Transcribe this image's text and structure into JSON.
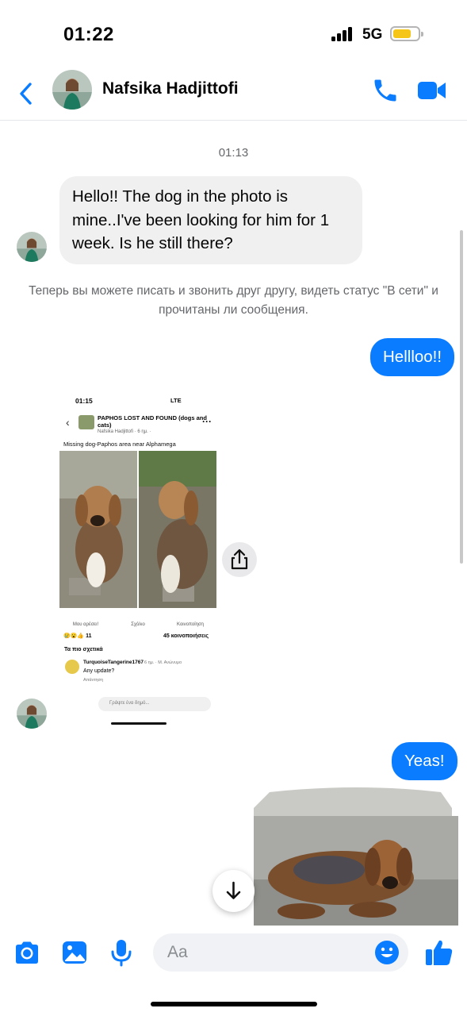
{
  "status_bar": {
    "time": "01:22",
    "network": "5G",
    "battery_color": "#f5c518"
  },
  "header": {
    "contact_name": "Nafsika Hadjittofi",
    "back_icon": "chevron-left-icon",
    "call_icon": "phone-icon",
    "video_icon": "video-camera-icon",
    "accent": "#0a7cff"
  },
  "chat": {
    "timestamp": "01:13",
    "messages": [
      {
        "direction": "incoming",
        "text": "Hello!! The dog in the photo is mine..I've been looking for him for 1 week. Is he still there?"
      },
      {
        "direction": "system",
        "text": "Теперь вы можете писать и звонить друг другу, видеть статус \"В сети\" и прочитаны ли сообщения."
      },
      {
        "direction": "outgoing",
        "text": "Hellloo!!"
      },
      {
        "direction": "outgoing",
        "text": "Yeas!"
      }
    ],
    "shared_screenshot": {
      "time": "01:15",
      "status": "LTE",
      "group_name": "PAPHOS LOST AND FOUND (dogs and cats)",
      "author": "Nafsika Hadjittofi · 6 ημ. · ",
      "caption": "Missing dog-Paphos area near Alphamega",
      "actions": [
        "Μου αρέσει!",
        "Σχόλιο",
        "Κοινοποίηση"
      ],
      "reaction_count": "11",
      "shares": "45 κοινοποιήσεις",
      "relevant_label": "Τα πιο σχετικά",
      "comment": {
        "author": "TurquoiseTangerine1767",
        "time": "6 ημ. · Μ. Ανώνυμο",
        "text": "Any update?",
        "reply": "Απάντηση"
      },
      "composer_placeholder": "Γράψτε ένα δημό..."
    }
  },
  "composer": {
    "placeholder": "Aa",
    "camera_icon": "camera-icon",
    "gallery_icon": "image-icon",
    "mic_icon": "microphone-icon",
    "emoji_icon": "emoji-icon",
    "like_icon": "thumbs-up-icon"
  }
}
